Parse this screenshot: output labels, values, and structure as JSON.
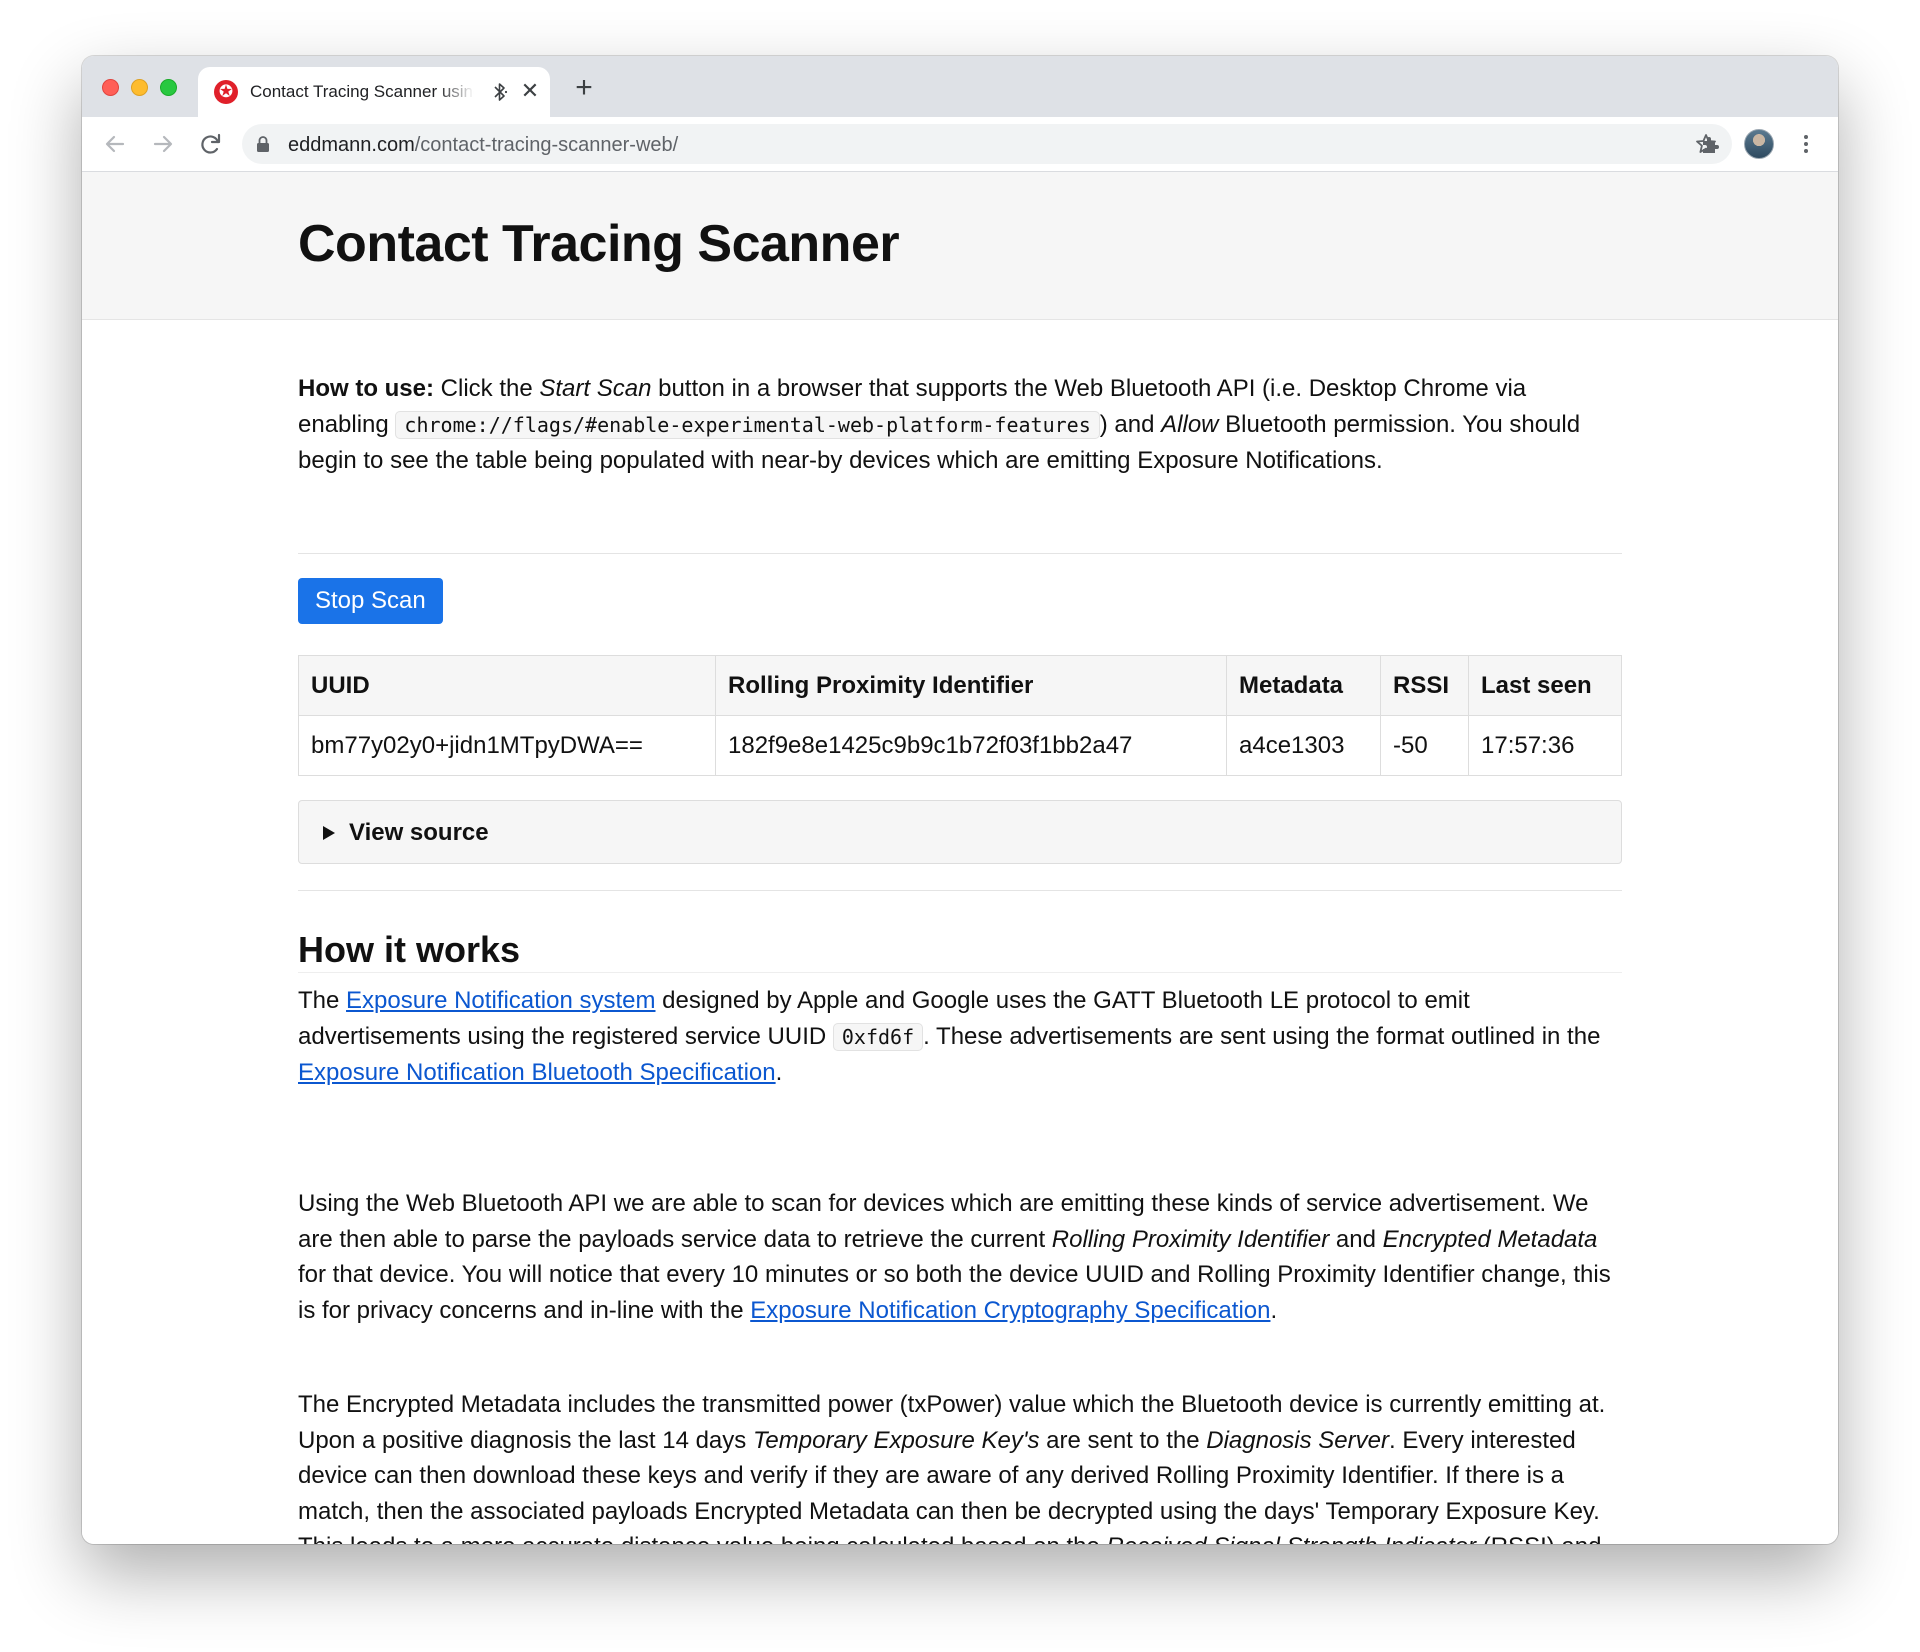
{
  "browser": {
    "tab_title": "Contact Tracing Scanner using Web Bluetooth",
    "close_glyph": "✕",
    "new_tab_glyph": "+",
    "url_host": "eddmann.com",
    "url_path": "/contact-tracing-scanner-web/",
    "favicon_glyph": "✪"
  },
  "page": {
    "title": "Contact Tracing Scanner",
    "how_to_use": {
      "lead": "How to use:",
      "t1": " Click the ",
      "start_scan": "Start Scan",
      "t2": " button in a browser that supports the Web Bluetooth API (i.e. Desktop Chrome via enabling ",
      "flag": "chrome://flags/#enable-experimental-web-platform-features",
      "t3": ") and ",
      "allow": "Allow",
      "t4": " Bluetooth permission. You should begin to see the table being populated with near-by devices which are emitting Exposure Notifications."
    },
    "scan_button": "Stop Scan",
    "table": {
      "headers": [
        "UUID",
        "Rolling Proximity Identifier",
        "Metadata",
        "RSSI",
        "Last seen"
      ],
      "rows": [
        [
          "bm77y02y0+jidn1MTpyDWA==",
          "182f9e8e1425c9b9c1b72f03f1bb2a47",
          "a4ce1303",
          "-50",
          "17:57:36"
        ]
      ]
    },
    "view_source": "View source",
    "how_it_works": {
      "title": "How it works",
      "p1": {
        "t1": "The ",
        "link1": "Exposure Notification system",
        "t2": " designed by Apple and Google uses the GATT Bluetooth LE protocol to emit advertisements using the registered service UUID ",
        "uuid": "0xfd6f",
        "t3": ". These advertisements are sent using the format outlined in the ",
        "link2": "Exposure Notification Bluetooth Specification",
        "t4": "."
      },
      "p2": {
        "t1": "Using the Web Bluetooth API we are able to scan for devices which are emitting these kinds of service advertisement. We are then able to parse the payloads service data to retrieve the current ",
        "rpi": "Rolling Proximity Identifier",
        "t2": " and ",
        "em": "Encrypted Metadata",
        "t3": " for that device. You will notice that every 10 minutes or so both the device UUID and Rolling Proximity Identifier change, this is for privacy concerns and in-line with the ",
        "link": "Exposure Notification Cryptography Specification",
        "t4": "."
      },
      "p3": {
        "t1": "The Encrypted Metadata includes the transmitted power (txPower) value which the Bluetooth device is currently emitting at. Upon a positive diagnosis the last 14 days ",
        "tek": "Temporary Exposure Key's",
        "t2": " are sent to the ",
        "ds": "Diagnosis Server",
        "t3": ". Every interested device can then download these keys and verify if they are aware of any derived Rolling Proximity Identifier. If there is a match, then the associated payloads Encrypted Metadata can then be decrypted using the days' Temporary Exposure Key. This leads to a more accurate distance value being calculated based on the ",
        "rssi": "Received Signal Strength Indicator",
        "t4": " (RSSI) and transmitted power."
      }
    }
  },
  "icons": [
    "back-arrow-icon",
    "forward-arrow-icon",
    "reload-icon",
    "lock-icon",
    "star-icon",
    "extensions-icon",
    "profile-avatar",
    "more-menu-icon",
    "bluetooth-icon"
  ]
}
